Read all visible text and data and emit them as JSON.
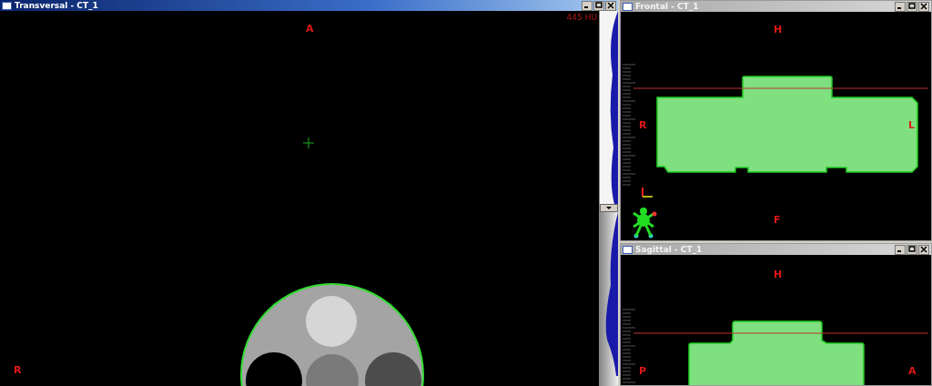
{
  "windows": [
    {
      "kind": "transversal",
      "title": "Transversal - CT_1",
      "active": true,
      "hu_readout": "445 HU",
      "orientation_labels": {
        "top": "A",
        "left": "R"
      }
    },
    {
      "kind": "frontal",
      "title": "Frontal - CT_1",
      "active": false,
      "orientation_labels": {
        "top": "H",
        "left": "R",
        "right": "L",
        "bottom": "F"
      }
    },
    {
      "kind": "sagittal",
      "title": "Sagittal - CT_1",
      "active": false,
      "orientation_labels": {
        "top": "H",
        "left": "P",
        "right": "A"
      }
    }
  ]
}
